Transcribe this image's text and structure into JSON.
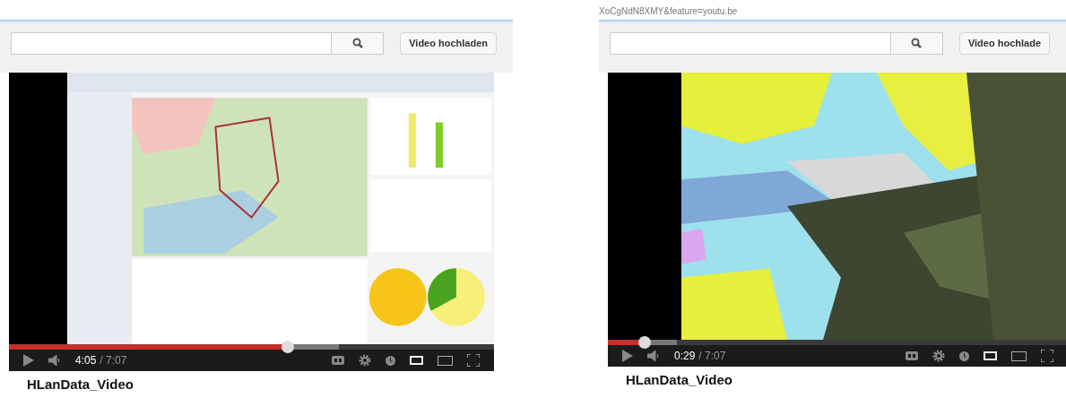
{
  "panels": [
    {
      "upload_button": "Video hochladen",
      "video": {
        "kind": "picture",
        "progress": {
          "level": 0.575
        },
        "buffer": {
          "level": 0.68
        },
        "time_current": "4:05",
        "time_total": "/ 7:07"
      },
      "title": "HLanData_Video"
    },
    {
      "url": "XoCgNdN8XMY&feature=youtu.be",
      "upload_button": "Video hochlade",
      "video": {
        "kind": "picture",
        "progress": {
          "level": 0.08
        },
        "buffer": {
          "level": 0.15
        },
        "time_current": "0:29",
        "time_total": "/ 7:07"
      },
      "title": "HLanData_Video"
    }
  ]
}
